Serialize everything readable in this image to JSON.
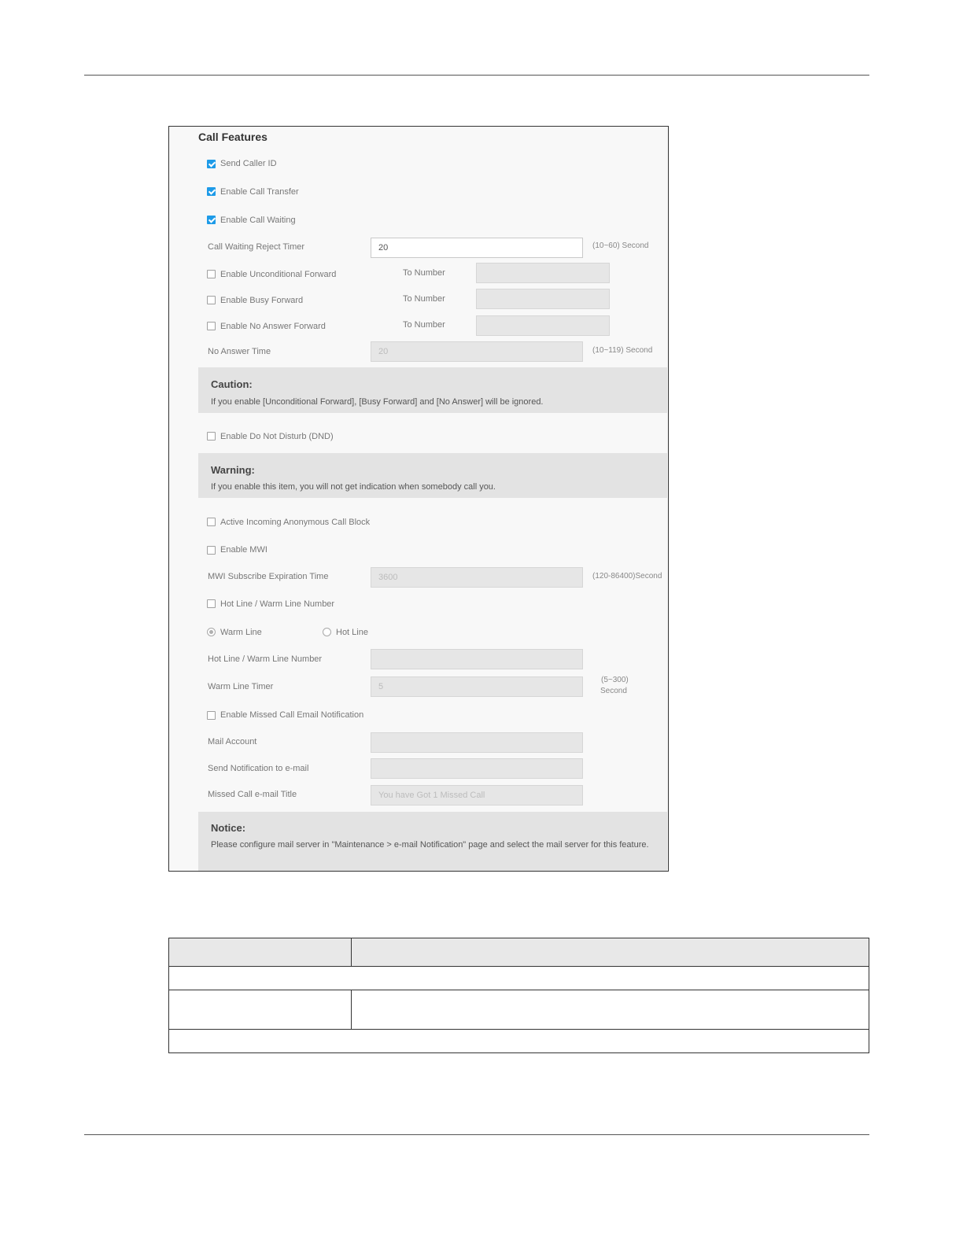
{
  "section_title": "Call Features",
  "send_caller_id": {
    "label": "Send Caller ID",
    "checked": true
  },
  "enable_call_transfer": {
    "label": "Enable Call Transfer",
    "checked": true
  },
  "enable_call_waiting": {
    "label": "Enable Call Waiting",
    "checked": true
  },
  "call_waiting_reject_timer": {
    "label": "Call Waiting Reject Timer",
    "value": "20",
    "hint": "(10~60) Second"
  },
  "unconditional_forward": {
    "label": "Enable Unconditional Forward",
    "to_label": "To Number",
    "checked": false
  },
  "busy_forward": {
    "label": "Enable Busy Forward",
    "to_label": "To Number",
    "checked": false
  },
  "no_answer_forward": {
    "label": "Enable No Answer Forward",
    "to_label": "To Number",
    "checked": false
  },
  "no_answer_time": {
    "label": "No Answer Time",
    "value": "20",
    "hint": "(10~119) Second"
  },
  "caution": {
    "title": "Caution:",
    "text": "If you enable [Unconditional Forward], [Busy Forward] and [No Answer] will be ignored."
  },
  "dnd": {
    "label": "Enable Do Not Disturb (DND)",
    "checked": false
  },
  "warning": {
    "title": "Warning:",
    "text": "If you enable this item, you will not get indication when somebody call you."
  },
  "anonymous_block": {
    "label": "Active Incoming Anonymous Call Block",
    "checked": false
  },
  "mwi": {
    "label": "Enable MWI",
    "checked": false
  },
  "mwi_expiration": {
    "label": "MWI Subscribe Expiration Time",
    "value": "3600",
    "hint": "(120-86400)Second"
  },
  "hot_warm_line": {
    "label": "Hot Line / Warm Line Number",
    "checked": false
  },
  "line_type": {
    "warm": "Warm Line",
    "hot": "Hot Line",
    "selected": "warm"
  },
  "hot_warm_number": {
    "label": "Hot Line / Warm Line Number",
    "value": ""
  },
  "warm_line_timer": {
    "label": "Warm Line Timer",
    "value": "5",
    "hint_1": "(5~300)",
    "hint_2": "Second"
  },
  "missed_call_email": {
    "label": "Enable Missed Call Email Notification",
    "checked": false
  },
  "mail_account": {
    "label": "Mail Account",
    "value": ""
  },
  "send_notification": {
    "label": "Send Notification to e-mail",
    "value": ""
  },
  "missed_call_title": {
    "label": "Missed Call e-mail Title",
    "value": "You have Got 1 Missed Call"
  },
  "notice": {
    "title": "Notice:",
    "text": "Please configure mail server in \"Maintenance > e-mail Notification\" page and select the mail server for this feature."
  },
  "colors": {
    "checkbox_accent": "#1e9be8",
    "banner_bg": "#e3e3e3",
    "disabled_field": "#e6e6e6"
  }
}
